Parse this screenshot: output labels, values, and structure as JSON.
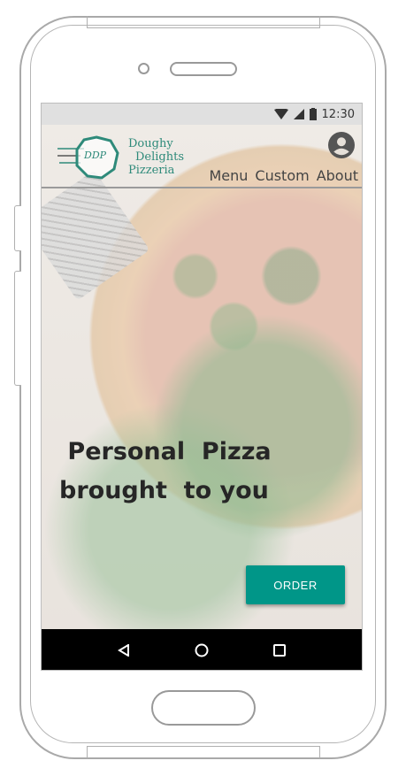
{
  "status_bar": {
    "time": "12:30",
    "icons": [
      "wifi-icon",
      "signal-icon",
      "battery-icon"
    ]
  },
  "header": {
    "logo_monogram": "DDP",
    "brand_lines": [
      "Doughy",
      "Delights",
      "Pizzeria"
    ],
    "nav": [
      "Menu",
      "Custom",
      "About"
    ],
    "account_icon": "account-circle-icon"
  },
  "hero": {
    "line1": " Personal  Pizza",
    "line2": "brought  to you"
  },
  "order_button": "ORDER",
  "system_nav": [
    "back-icon",
    "home-icon",
    "recents-icon"
  ],
  "colors": {
    "accent": "#009688",
    "brand": "#2e8a7a"
  }
}
